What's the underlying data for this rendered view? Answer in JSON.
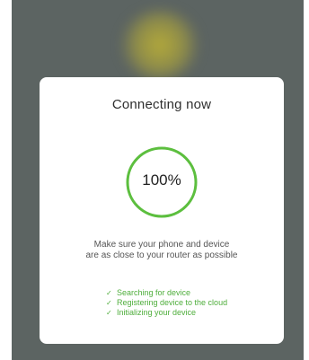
{
  "dialog": {
    "title": "Connecting now",
    "progress": {
      "value": 100,
      "label": "100%",
      "ring_color": "#5cbf3e"
    },
    "instruction_lines": [
      "Make sure your phone and device",
      "are as close to your router as possible"
    ],
    "steps": [
      {
        "icon": "check-icon",
        "label": "Searching for device",
        "done": true
      },
      {
        "icon": "check-icon",
        "label": "Registering device to the cloud",
        "done": true
      },
      {
        "icon": "check-icon",
        "label": "Initializing your device",
        "done": true
      }
    ]
  },
  "colors": {
    "backdrop": "#5c6462",
    "dialog_bg": "#ffffff",
    "accent_green": "#4fae3c"
  }
}
